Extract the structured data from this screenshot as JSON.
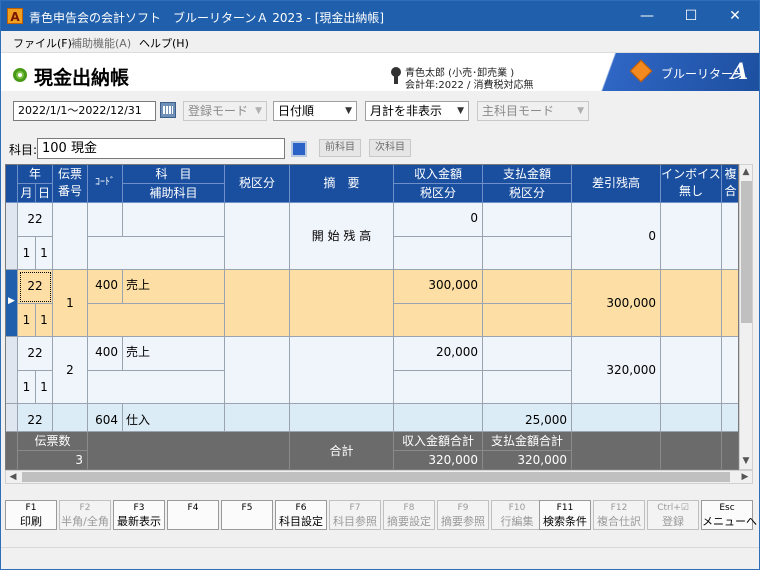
{
  "window": {
    "title": "青色申告会の会計ソフト　ブルーリターンＡ 2023 - [現金出納帳]",
    "app_icon_letter": "A",
    "minimize": "—",
    "maximize": "☐",
    "close": "✕"
  },
  "menu": {
    "file": "ファイル(F)",
    "aux": "補助機能(A)",
    "help": "ヘルプ(H)"
  },
  "header": {
    "title": "現金出納帳",
    "user_line1": "青色太郎 (小売･卸売業 )",
    "user_line2": "会計年:2022 / 消費税対応無",
    "brand_text": "ブルーリターン",
    "brand_letter": "A"
  },
  "toolbar": {
    "date_range": "2022/1/1～2022/12/31",
    "mode": "登録モード",
    "sort": "日付順",
    "monthly": "月計を非表示",
    "subject_mode": "主科目モード",
    "account_label": "科目:",
    "account_value": "100 現金",
    "prev_account": "前科目",
    "next_account": "次科目"
  },
  "grid": {
    "headers": {
      "year": "年",
      "month": "月",
      "day": "日",
      "slip_no": "伝票番号",
      "code": "ｺｰﾄﾞ",
      "account": "科　目",
      "sub_account": "補助科目",
      "tax1": "税区分",
      "summary": "摘　要",
      "income": "収入金額",
      "income_tax": "税区分",
      "payment": "支払金額",
      "payment_tax": "税区分",
      "balance": "差引残高",
      "invoice": "インボイス無し",
      "multi": "複合"
    },
    "rows": [
      {
        "year": "22",
        "month": "1",
        "day": "1",
        "slip": "",
        "code": "",
        "account": "",
        "summary": "開 始 残 高",
        "income": "0",
        "payment": "",
        "balance": "0"
      },
      {
        "year": "22",
        "month": "1",
        "day": "1",
        "slip": "1",
        "code": "400",
        "account": "売上",
        "summary": "",
        "income": "300,000",
        "payment": "",
        "balance": "300,000"
      },
      {
        "year": "22",
        "month": "1",
        "day": "1",
        "slip": "2",
        "code": "400",
        "account": "売上",
        "summary": "",
        "income": "20,000",
        "payment": "",
        "balance": "320,000"
      },
      {
        "year": "22",
        "month": "",
        "day": "",
        "slip": "",
        "code": "604",
        "account": "仕入",
        "summary": "",
        "income": "",
        "payment": "25,000",
        "balance": ""
      }
    ],
    "footer": {
      "slip_count_label": "伝票数",
      "slip_count": "3",
      "total_label": "合計",
      "income_total_label": "収入金額合計",
      "payment_total_label": "支払金額合計",
      "income_total": "320,000",
      "payment_total": "320,000"
    }
  },
  "fkeys": [
    {
      "key": "F1",
      "label": "印刷",
      "enabled": true
    },
    {
      "key": "F2",
      "label": "半角/全角",
      "enabled": false
    },
    {
      "key": "F3",
      "label": "最新表示",
      "enabled": true
    },
    {
      "key": "F4",
      "label": "",
      "enabled": true
    },
    {
      "key": "F5",
      "label": "",
      "enabled": true
    },
    {
      "key": "F6",
      "label": "科目設定",
      "enabled": true
    },
    {
      "key": "F7",
      "label": "科目参照",
      "enabled": false
    },
    {
      "key": "F8",
      "label": "摘要設定",
      "enabled": false
    },
    {
      "key": "F9",
      "label": "摘要参照",
      "enabled": false
    },
    {
      "key": "F10",
      "label": "行編集",
      "enabled": false
    },
    {
      "key": "F11",
      "label": "検索条件",
      "enabled": true
    },
    {
      "key": "F12",
      "label": "複合仕訳",
      "enabled": false
    },
    {
      "key": "Ctrl+☑",
      "label": "登録",
      "enabled": false
    },
    {
      "key": "Esc",
      "label": "メニューへ",
      "enabled": true
    }
  ],
  "colors": {
    "titlebar": "#1f5fab",
    "grid_header": "#1a4fa0",
    "selected_row": "#fddfa6",
    "odd_row": "#f0f4fb",
    "footer": "#6b6b6b"
  }
}
